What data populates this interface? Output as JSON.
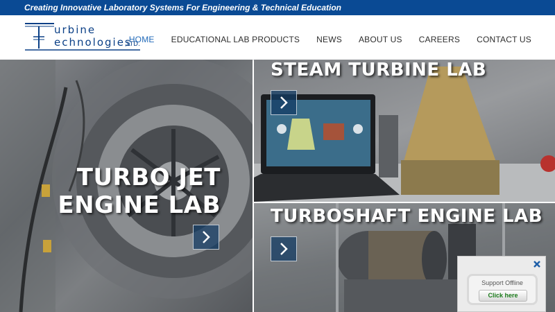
{
  "topbar": {
    "tagline": "Creating Innovative Laboratory Systems For Engineering & Technical Education"
  },
  "logo": {
    "line1": "urbine",
    "line2": "echnologies",
    "suffix": ",LTD."
  },
  "nav": {
    "items": [
      {
        "label": "HOME",
        "active": true
      },
      {
        "label": "EDUCATIONAL LAB PRODUCTS",
        "active": false
      },
      {
        "label": "NEWS",
        "active": false
      },
      {
        "label": "ABOUT US",
        "active": false
      },
      {
        "label": "CAREERS",
        "active": false
      },
      {
        "label": "CONTACT US",
        "active": false
      }
    ]
  },
  "panels": {
    "left": {
      "title_line1": "TURBO JET",
      "title_line2": "ENGINE LAB"
    },
    "right_top": {
      "title": "STEAM TURBINE LAB"
    },
    "right_bottom": {
      "title": "TURBOSHAFT ENGINE LAB"
    }
  },
  "support": {
    "status": "Support Offline",
    "button": "Click here"
  },
  "colors": {
    "brand_blue": "#0a4a94",
    "nav_active": "#1f68b8",
    "support_button_text": "#1a7a1a"
  },
  "icons": {
    "panel_arrow": "chevron-right-icon",
    "support_close": "close-icon"
  }
}
